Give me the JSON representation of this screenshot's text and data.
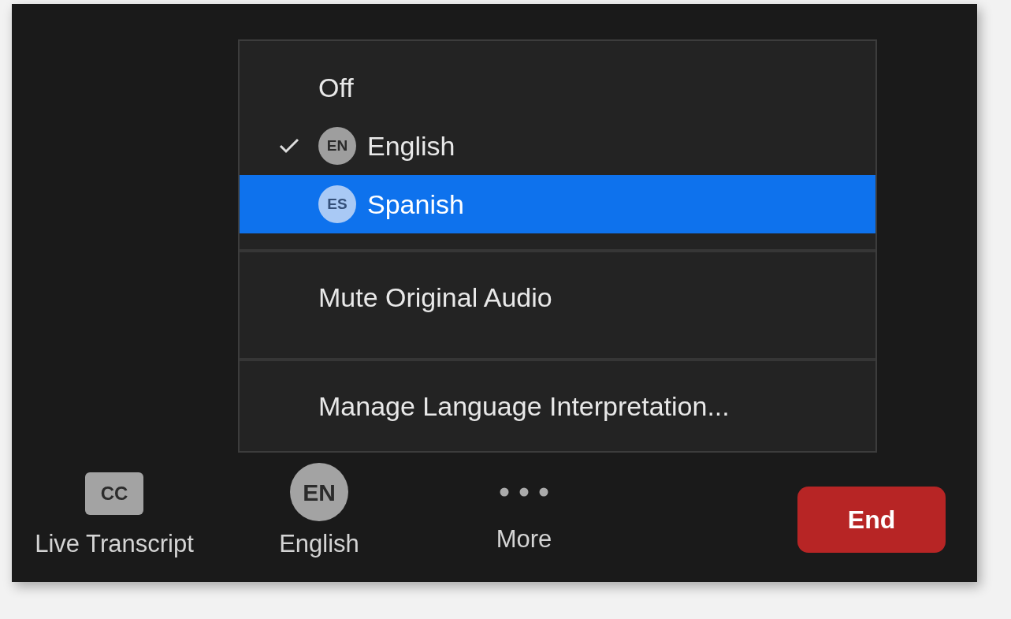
{
  "menu": {
    "items": [
      {
        "kind": "option",
        "label": "Off",
        "checked": false,
        "selected": false
      },
      {
        "kind": "option",
        "label": "English",
        "badge": "EN",
        "checked": true,
        "selected": false
      },
      {
        "kind": "option",
        "label": "Spanish",
        "badge": "ES",
        "checked": false,
        "selected": true
      },
      {
        "kind": "separator"
      },
      {
        "kind": "action",
        "label": "Mute Original Audio"
      },
      {
        "kind": "separator"
      },
      {
        "kind": "action",
        "label": "Manage Language Interpretation..."
      }
    ]
  },
  "toolbar": {
    "items": [
      {
        "kind": "caption",
        "icon_text": "CC",
        "label": "Live Transcript"
      },
      {
        "kind": "language",
        "icon_text": "EN",
        "label": "English"
      },
      {
        "kind": "more",
        "label": "More"
      }
    ],
    "end_button": "End"
  }
}
